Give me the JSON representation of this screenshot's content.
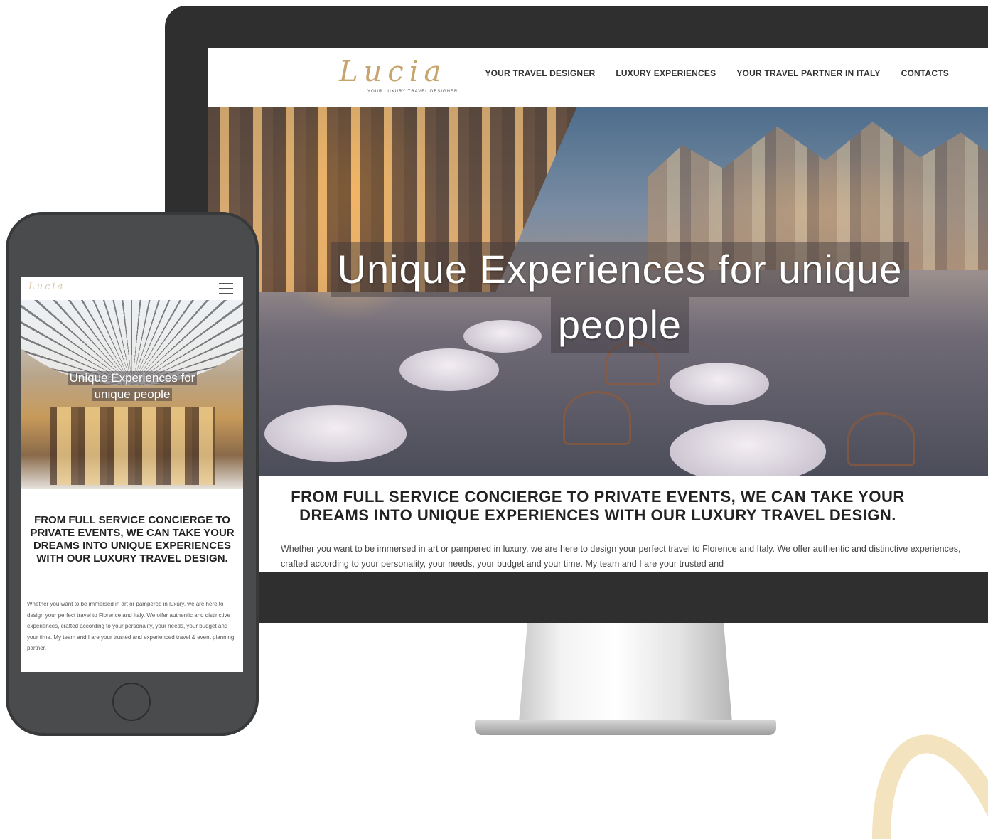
{
  "desktop": {
    "logo": {
      "script": "Lucia",
      "tagline": "YOUR LUXURY TRAVEL DESIGNER"
    },
    "nav": [
      {
        "label": "YOUR TRAVEL DESIGNER"
      },
      {
        "label": "LUXURY EXPERIENCES"
      },
      {
        "label": "YOUR TRAVEL PARTNER IN ITALY"
      },
      {
        "label": "CONTACTS"
      }
    ],
    "hero_title_line1": "Unique Experiences for unique",
    "hero_title_line2": "people",
    "heading_line1": "FROM FULL SERVICE CONCIERGE TO PRIVATE EVENTS, WE CAN TAKE YOUR",
    "heading_line2": "DREAMS INTO UNIQUE EXPERIENCES WITH OUR LUXURY TRAVEL DESIGN.",
    "paragraph": "Whether you want to be immersed in art or pampered in luxury, we are here to design your perfect travel to Florence and Italy. We offer authentic and distinctive experiences, crafted according to your personality, your needs, your budget and your time. My team and I are your trusted and"
  },
  "mobile": {
    "logo": "Lucia",
    "menu_icon": "hamburger-menu-icon",
    "hero_title_line1": "Unique Experiences for",
    "hero_title_line2": "unique people",
    "heading": "FROM FULL SERVICE CONCIERGE TO PRIVATE EVENTS, WE CAN TAKE YOUR DREAMS INTO UNIQUE EXPERIENCES WITH OUR LUXURY TRAVEL DESIGN.",
    "paragraph": "Whether you want to be immersed in art or pampered in luxury, we are here to design your perfect travel to Florence and Italy. We offer authentic and distinctive experiences, crafted according to your personality, your needs, your budget and your time. My team and I are your trusted and experienced travel & event planning partner."
  },
  "colors": {
    "accent_gold": "#c7a56e",
    "device_frame": "#2f2f30",
    "text_dark": "#222222"
  }
}
